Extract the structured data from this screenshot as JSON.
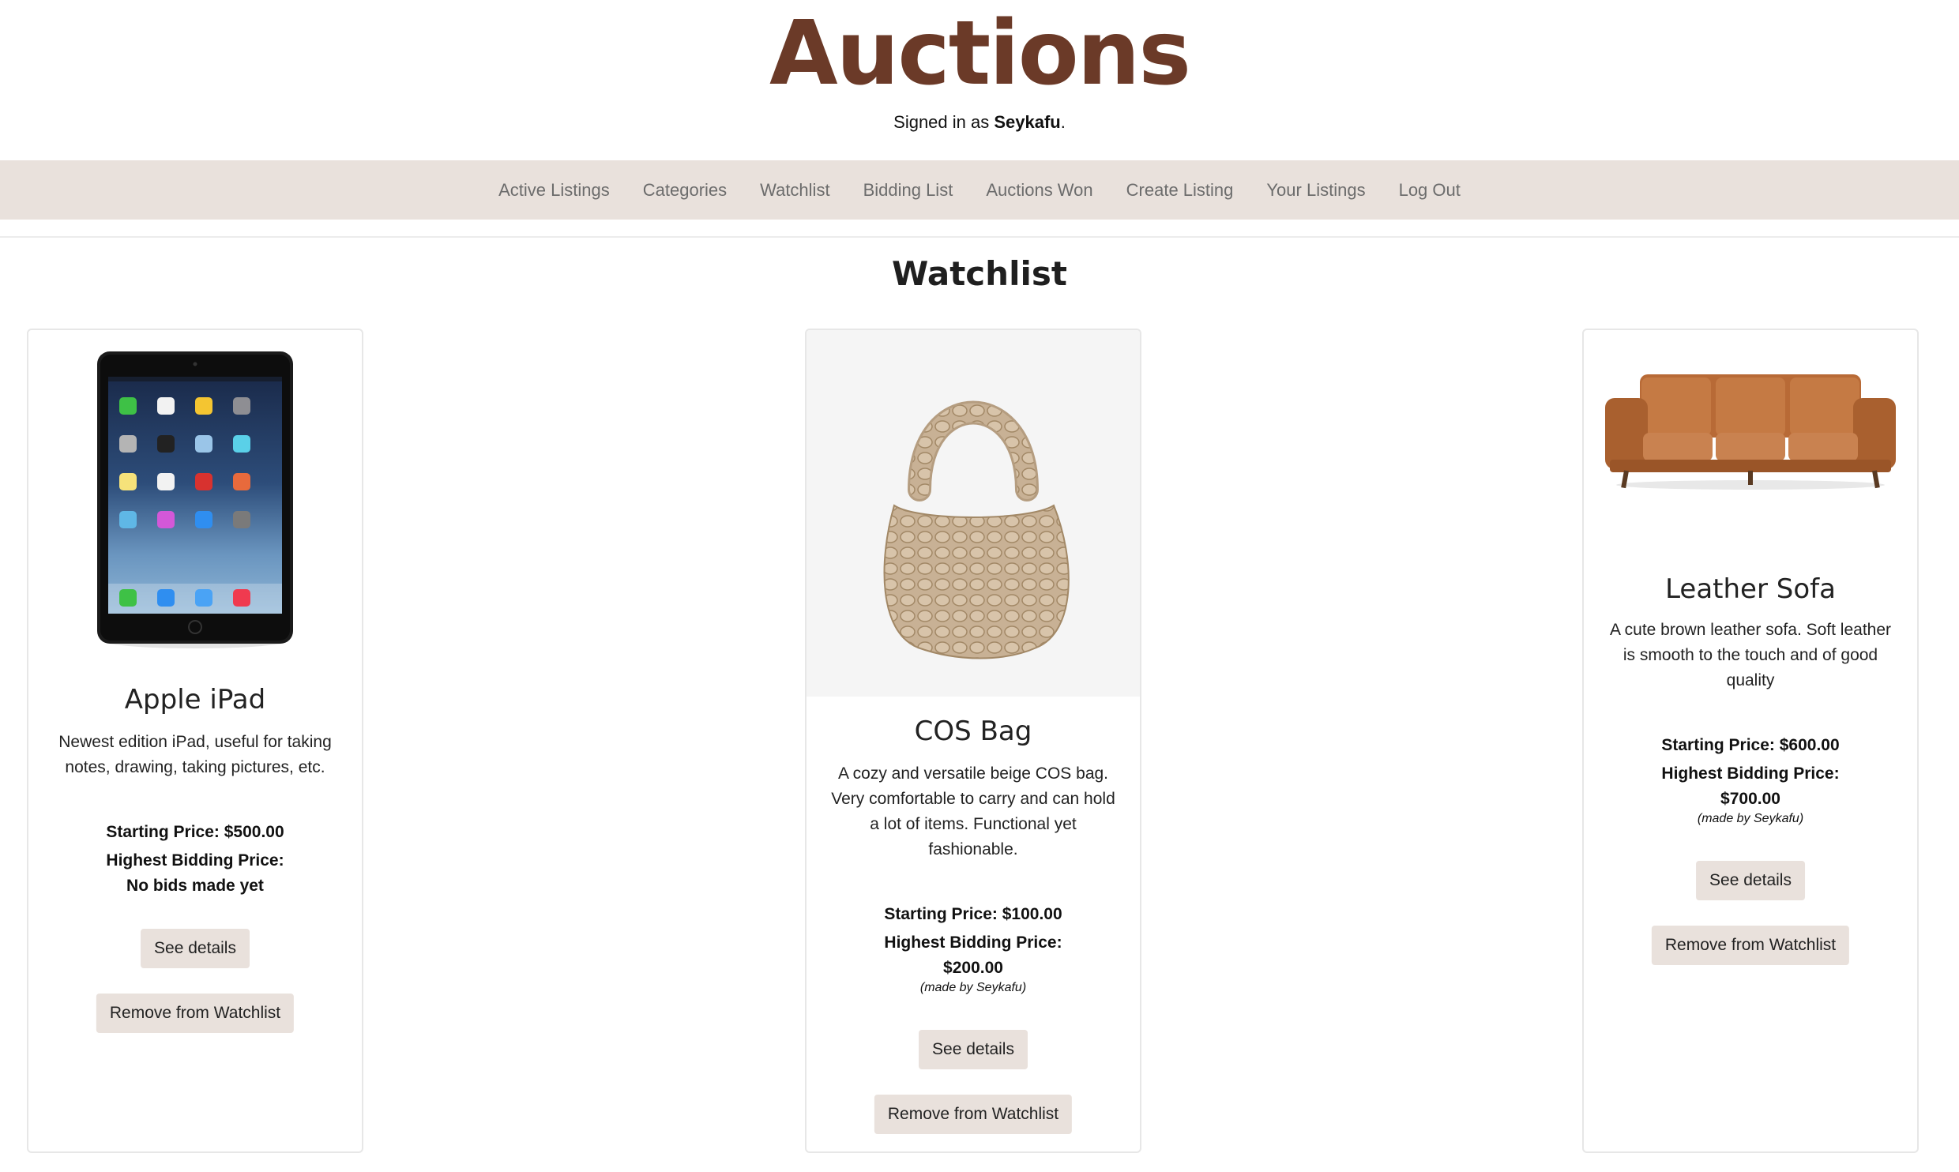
{
  "site": {
    "title": "Auctions",
    "signed_in_prefix": "Signed in as ",
    "username": "Seykafu",
    "signed_in_suffix": "."
  },
  "nav": {
    "items": [
      {
        "label": "Active Listings"
      },
      {
        "label": "Categories"
      },
      {
        "label": "Watchlist"
      },
      {
        "label": "Bidding List"
      },
      {
        "label": "Auctions Won"
      },
      {
        "label": "Create Listing"
      },
      {
        "label": "Your Listings"
      },
      {
        "label": "Log Out"
      }
    ]
  },
  "page": {
    "heading": "Watchlist"
  },
  "listings": [
    {
      "title": "Apple iPad",
      "description": "Newest edition iPad, useful for taking notes, drawing, taking pictures, etc.",
      "starting_price": "Starting Price: $500.00",
      "highest_bid_label": "Highest Bidding Price:",
      "highest_bid_value": "No bids made yet",
      "made_by": "",
      "details_label": "See details",
      "remove_label": "Remove from Watchlist"
    },
    {
      "title": "COS Bag",
      "description": "A cozy and versatile beige COS bag. Very comfortable to carry and can hold a lot of items. Functional yet fashionable.",
      "starting_price": "Starting Price: $100.00",
      "highest_bid_label": "Highest Bidding Price:",
      "highest_bid_value": "$200.00",
      "made_by": "(made by Seykafu)",
      "details_label": "See details",
      "remove_label": "Remove from Watchlist"
    },
    {
      "title": "Leather Sofa",
      "description": "A cute brown leather sofa. Soft leather is smooth to the touch and of good quality",
      "starting_price": "Starting Price: $600.00",
      "highest_bid_label": "Highest Bidding Price:",
      "highest_bid_value": "$700.00",
      "made_by": "(made by Seykafu)",
      "details_label": "See details",
      "remove_label": "Remove from Watchlist"
    }
  ],
  "colors": {
    "brand": "#6b3a28",
    "nav_background": "#e9e1dc",
    "button_background": "#e9e1dc"
  }
}
